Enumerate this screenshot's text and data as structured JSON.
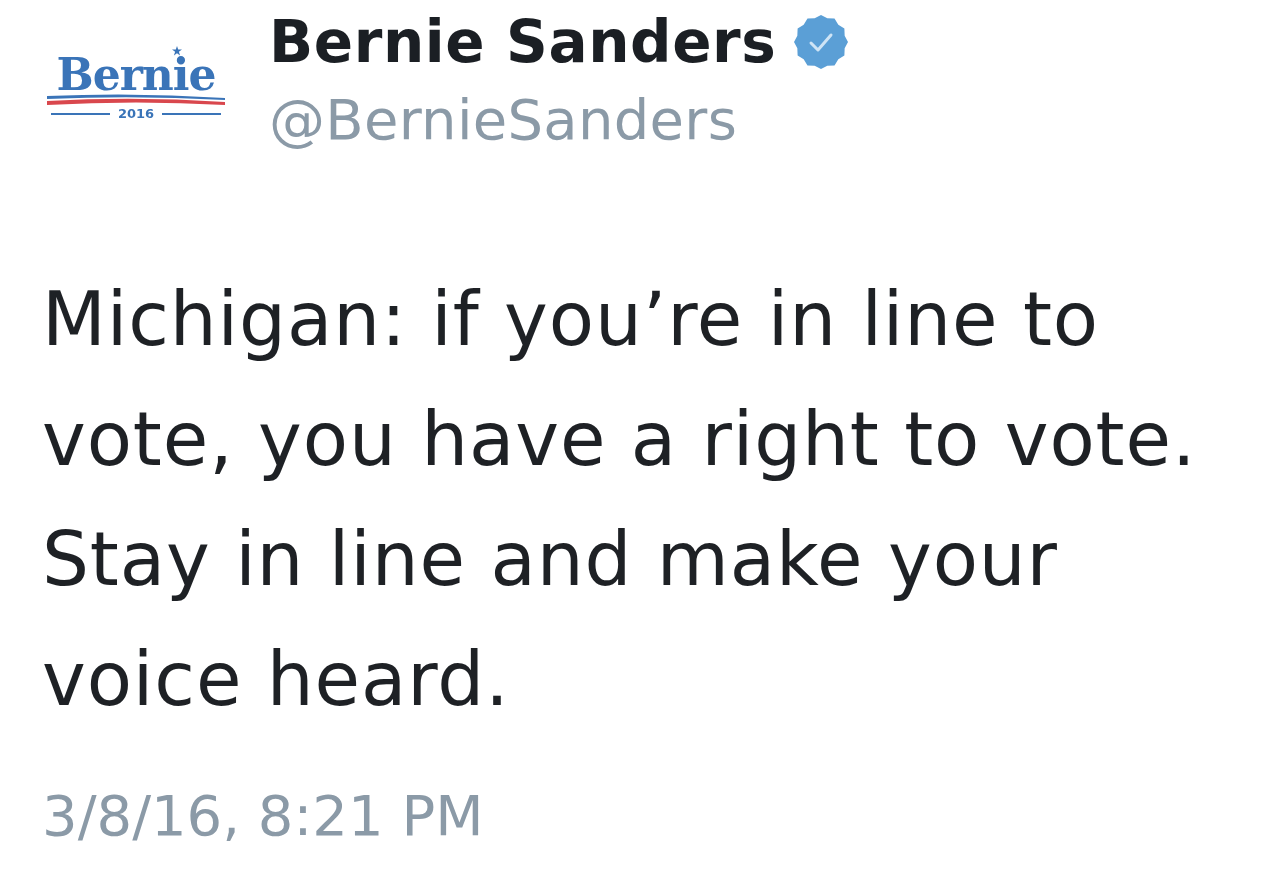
{
  "profile": {
    "logo": {
      "wordmark": "Bernie",
      "year": "2016"
    },
    "name": "Bernie Sanders",
    "verified": true,
    "handle": "@BernieSanders"
  },
  "tweet": {
    "text": "Michigan: if you’re in line to vote, you have a right to vote. Stay in line and make your voice heard.",
    "timestamp": "3/8/16, 8:21 PM"
  }
}
